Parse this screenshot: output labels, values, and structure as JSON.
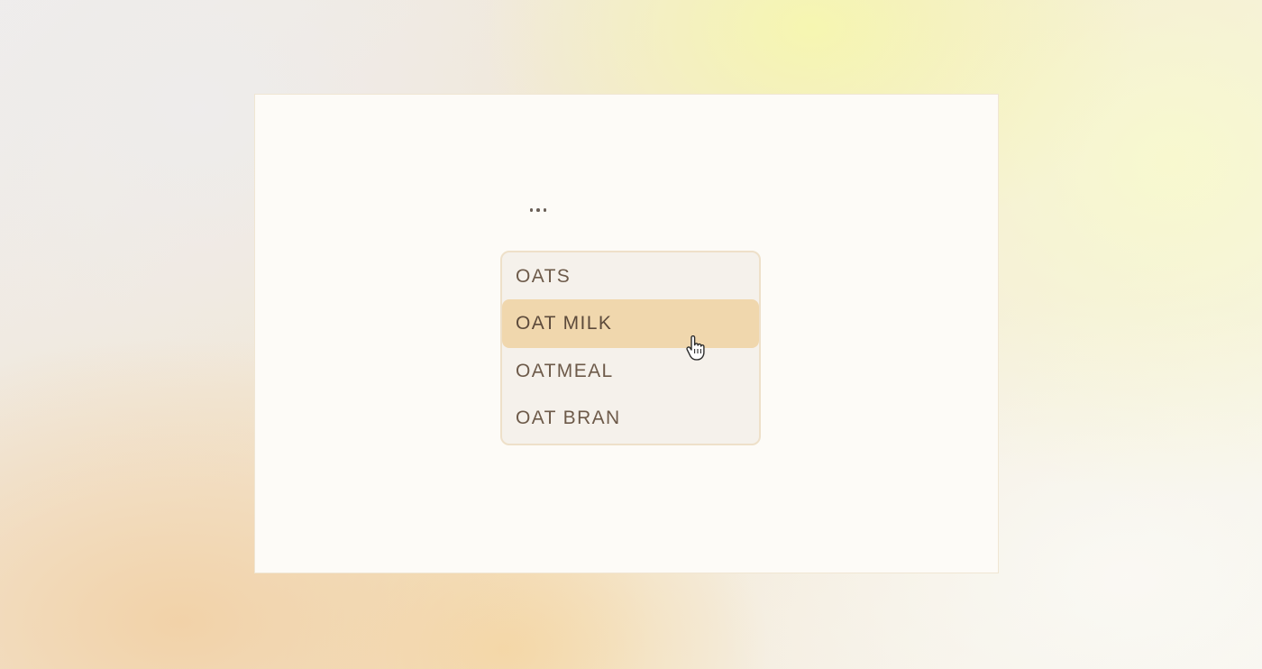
{
  "menu": {
    "trigger_icon": "more-horizontal-icon",
    "items": [
      {
        "label": "OATS",
        "state": "default"
      },
      {
        "label": "OAT MILK",
        "state": "highlighted"
      },
      {
        "label": "OATMEAL",
        "state": "default"
      },
      {
        "label": "OAT BRAN",
        "state": "default"
      }
    ]
  },
  "cursor": {
    "icon": "hand-pointer-icon"
  },
  "colors": {
    "card_background": "#fdfbf7",
    "menu_background": "#f5f1eb",
    "menu_border": "#eee0c9",
    "highlight": "#f0d7ad",
    "item_text": "#6d5a49"
  }
}
